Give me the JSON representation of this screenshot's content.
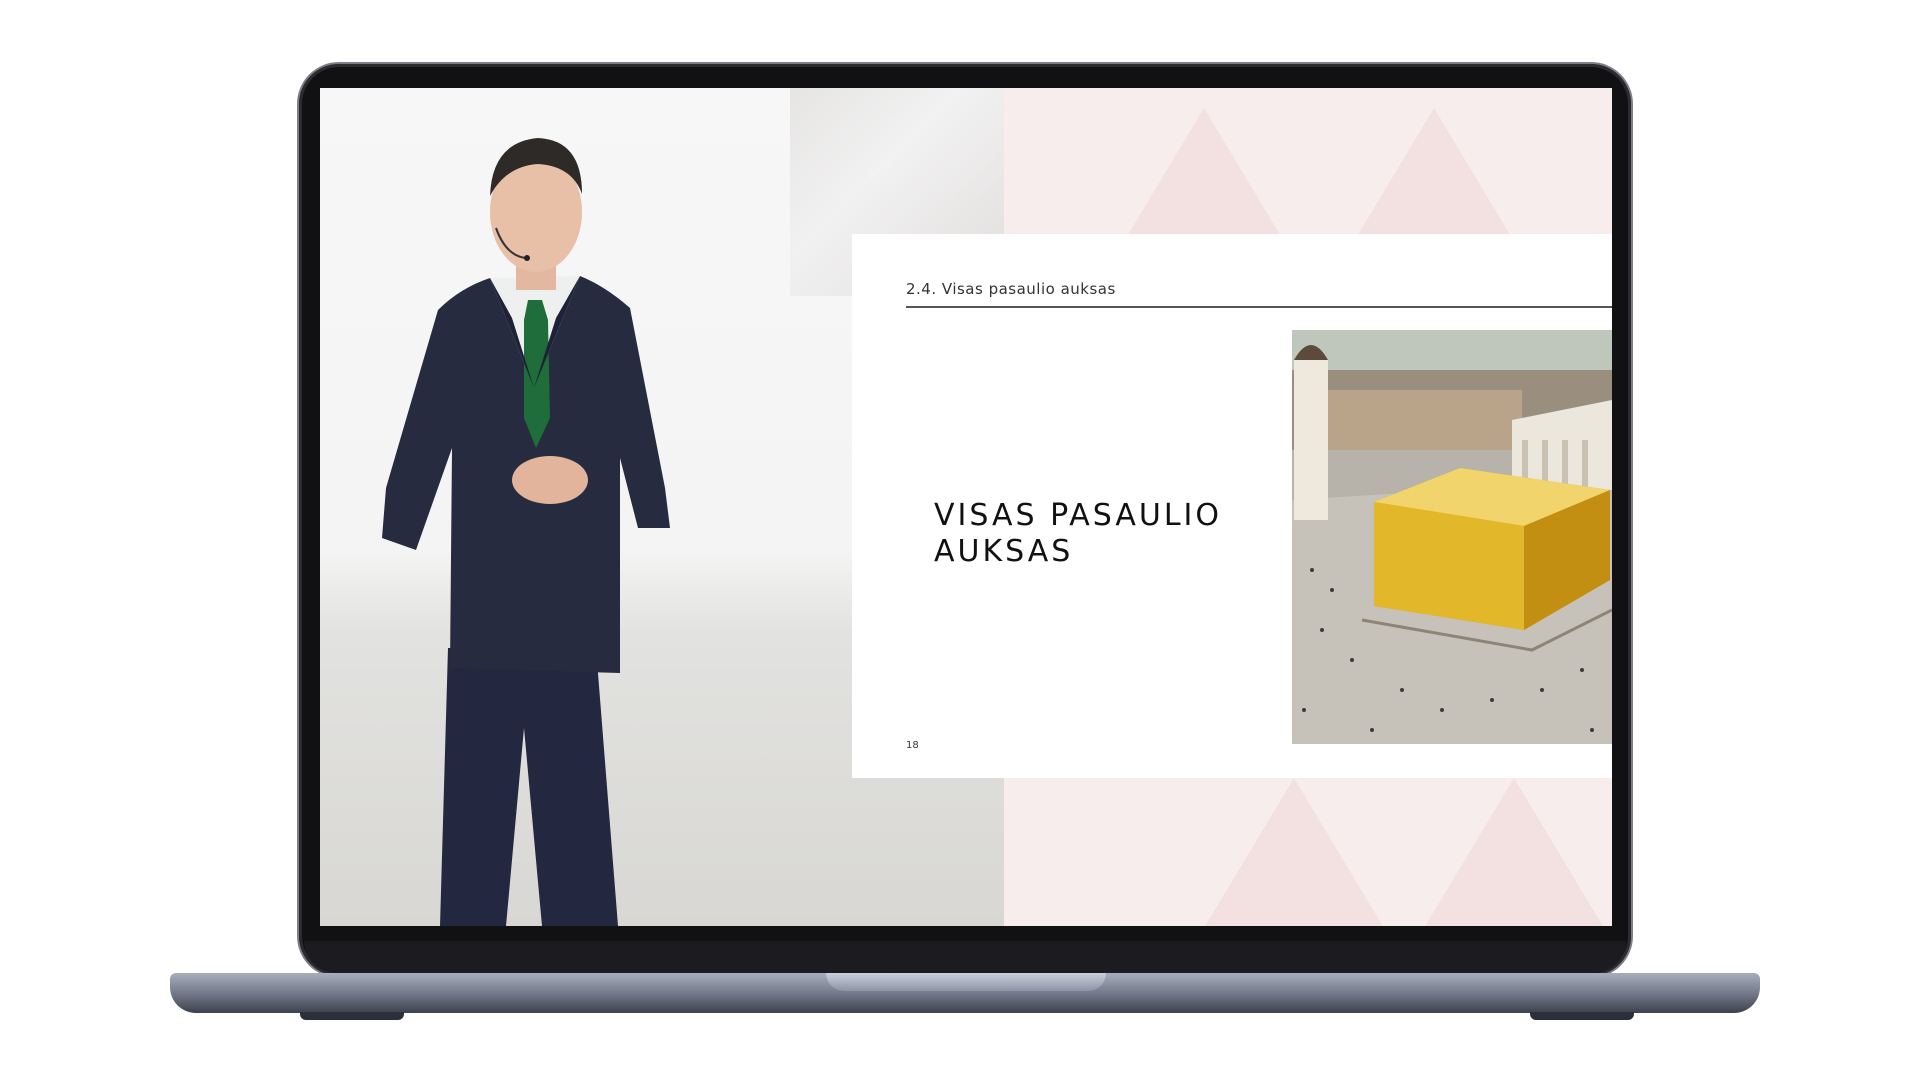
{
  "slide": {
    "section": "2.4. Visas pasaulio auksas",
    "title_lines": [
      "VISAS PASAULIO",
      "AUKSAS"
    ],
    "page_number": "18"
  },
  "colors": {
    "slide_background": "#ffffff",
    "pink_screen": "#f8eded",
    "gold": "#e2b72a",
    "suit": "#262b3f",
    "tie": "#1f6d3a"
  },
  "icons": {
    "speaker": "presenter-photo",
    "slide_image": "gold-cube-in-city-square-photo"
  }
}
